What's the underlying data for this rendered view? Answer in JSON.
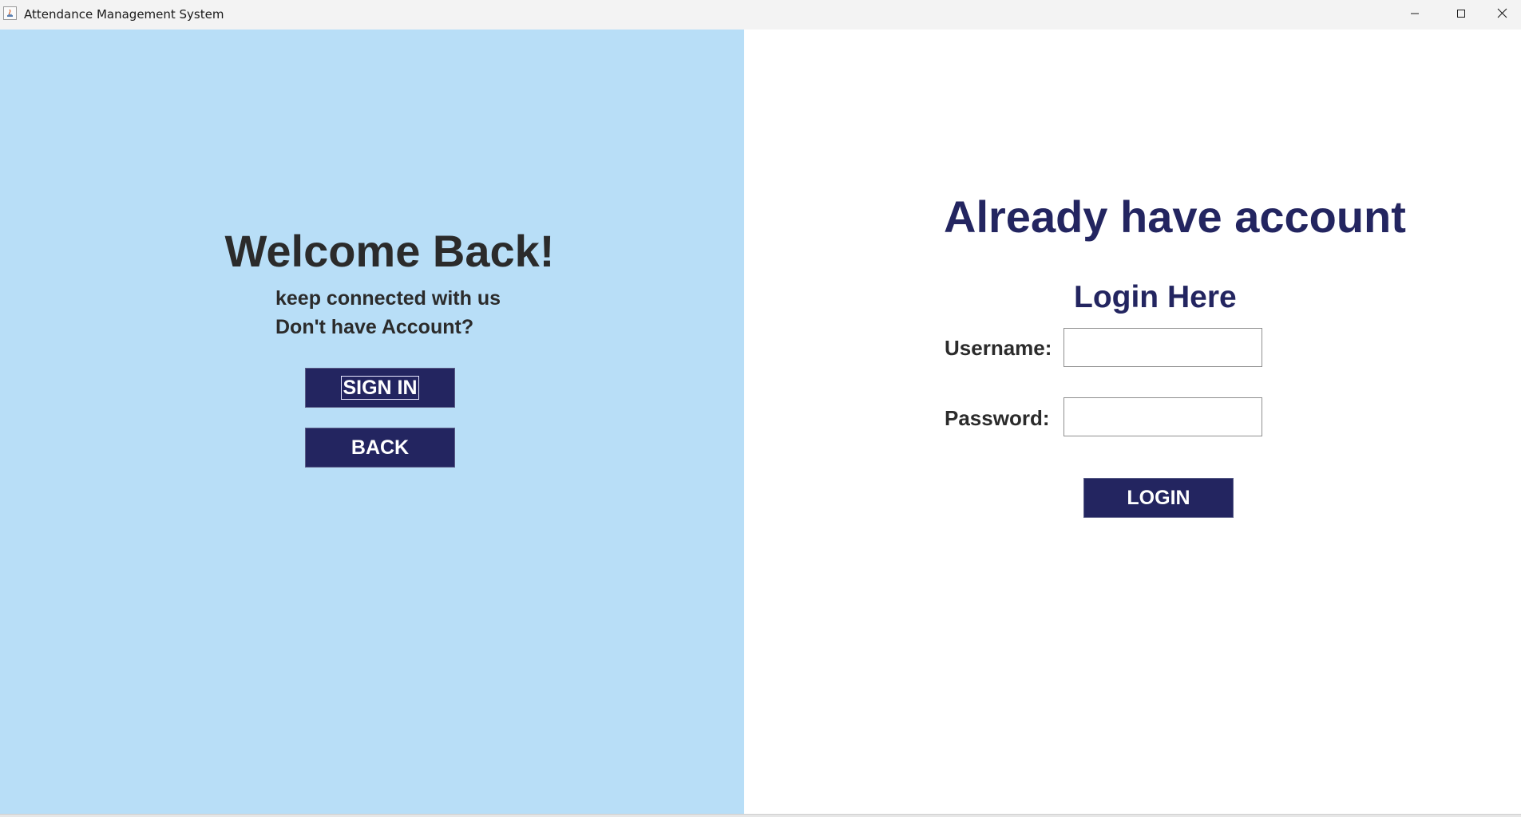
{
  "window": {
    "title": "Attendance Management System",
    "controls": {
      "minimize": "minimize-icon",
      "maximize": "maximize-icon",
      "close": "close-icon"
    }
  },
  "left_panel": {
    "background": "#b8def7",
    "heading": "Welcome Back!",
    "line1": "keep connected with us",
    "line2": "Don't have Account?",
    "sign_in_label": "SIGN IN",
    "back_label": "BACK"
  },
  "right_panel": {
    "heading": "Already have account",
    "subheading": "Login Here",
    "username_label": "Username:",
    "username_value": "",
    "password_label": "Password:",
    "password_value": "",
    "login_label": "LOGIN"
  },
  "colors": {
    "accent": "#232560",
    "text_dark": "#2b2b2b",
    "left_bg": "#b8def7"
  }
}
